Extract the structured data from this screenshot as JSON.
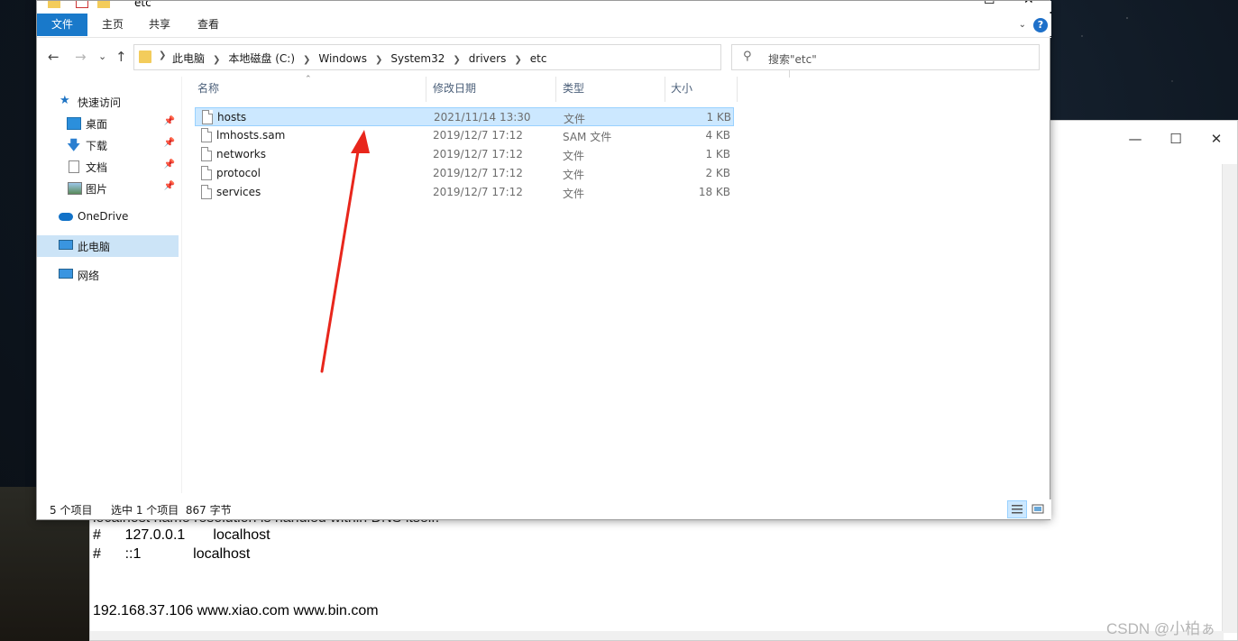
{
  "desktop": {
    "watermark": "CSDN @小柏ぁ"
  },
  "notepad": {
    "controls": {
      "minimize": "—",
      "maximize": "☐",
      "close": "✕"
    },
    "lines": [
      {
        "text": "#\t127.0.0.1       localhost"
      },
      {
        "text": "#\t::1             localhost"
      },
      {
        "text": "192.168.37.106 www.xiao.com www.bin.com"
      }
    ],
    "partial_line": "localhost name resolution is handled within DNS itself."
  },
  "explorer": {
    "title": "etc",
    "window_controls": {
      "minimize": "—",
      "maximize": "☐",
      "close": "✕"
    },
    "ribbon_tabs": [
      "文件",
      "主页",
      "共享",
      "查看"
    ],
    "nav": {
      "back": "←",
      "forward": "→",
      "recent": "⌄",
      "up": "↑"
    },
    "breadcrumb": [
      "此电脑",
      "本地磁盘 (C:)",
      "Windows",
      "System32",
      "drivers",
      "etc"
    ],
    "search_placeholder": "搜索\"etc\"",
    "sidebar": {
      "quick_access": "快速访问",
      "pinned": [
        "桌面",
        "下载",
        "文档",
        "图片"
      ],
      "onedrive": "OneDrive",
      "this_pc": "此电脑",
      "network": "网络"
    },
    "columns": {
      "name": "名称",
      "date": "修改日期",
      "type": "类型",
      "size": "大小"
    },
    "files": [
      {
        "name": "hosts",
        "date": "2021/11/14 13:30",
        "type": "文件",
        "size": "1 KB",
        "selected": true
      },
      {
        "name": "lmhosts.sam",
        "date": "2019/12/7 17:12",
        "type": "SAM 文件",
        "size": "4 KB",
        "selected": false
      },
      {
        "name": "networks",
        "date": "2019/12/7 17:12",
        "type": "文件",
        "size": "1 KB",
        "selected": false
      },
      {
        "name": "protocol",
        "date": "2019/12/7 17:12",
        "type": "文件",
        "size": "2 KB",
        "selected": false
      },
      {
        "name": "services",
        "date": "2019/12/7 17:12",
        "type": "文件",
        "size": "18 KB",
        "selected": false
      }
    ],
    "status": {
      "count": "5 个项目",
      "selection": "选中 1 个项目  867 字节"
    }
  },
  "annotation_color": "#e8261c"
}
